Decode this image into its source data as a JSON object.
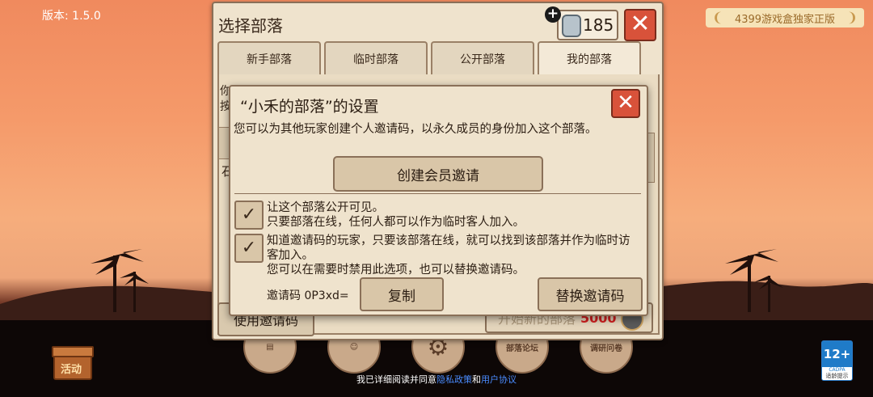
{
  "version_text": "版本: 1.5.0",
  "badge_4399": "4399游戏盒独家正版",
  "panel": {
    "title": "选择部落",
    "currency_value": "185",
    "tabs": [
      "新手部落",
      "临时部落",
      "公开部落",
      "我的部落"
    ],
    "active_tab": "我的部落",
    "use_code_label": "使用邀请码",
    "new_tribe_label": "开始新的部落",
    "new_tribe_cost": "5000",
    "partial_text_1": "你",
    "partial_text_2": "按",
    "partial_text_3": "石"
  },
  "dialog": {
    "title": "“小禾的部落”的设置",
    "description": "您可以为其他玩家创建个人邀请码，以永久成员的身份加入这个部落。",
    "create_button": "创建会员邀请",
    "option1_line1": "让这个部落公开可见。",
    "option1_line2": "只要部落在线，任何人都可以作为临时客人加入。",
    "option2_line1": "知道邀请码的玩家，只要该部落在线，就可以找到该部落并作为临时访客加入。",
    "option2_line2": "您可以在需要时禁用此选项，也可以替换邀请码。",
    "option1_checked": true,
    "option2_checked": true,
    "invite_code_label": "邀请码 0P3xd=",
    "copy_button": "复制",
    "replace_button": "替换邀请码"
  },
  "bottom": {
    "activity_label": "活动",
    "forum_label": "部落论坛",
    "survey_label": "调研问卷",
    "age_rating": "12+",
    "age_sub": "CADPA",
    "age_tip": "适龄提示",
    "footer_prefix": "我已详细阅读并同意",
    "privacy_link": "隐私政策",
    "footer_and": "和",
    "user_agreement_link": "用户协议"
  }
}
